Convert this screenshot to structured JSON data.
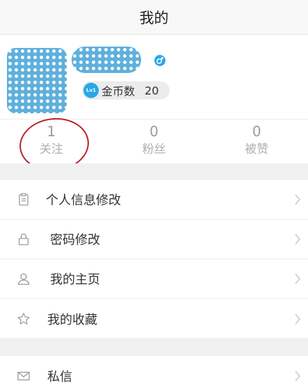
{
  "header": {
    "title": "我的"
  },
  "profile": {
    "coin_label": "金币数",
    "coin_value": "20",
    "level_badge": "Lv1",
    "gender_icon": "male-icon"
  },
  "stats": [
    {
      "value": "1",
      "label": "关注"
    },
    {
      "value": "0",
      "label": "粉丝"
    },
    {
      "value": "0",
      "label": "被赞"
    }
  ],
  "menu": [
    {
      "label": "个人信息修改",
      "icon": "clipboard-icon"
    },
    {
      "label": "密码修改",
      "icon": "lock-icon"
    },
    {
      "label": "我的主页",
      "icon": "user-icon"
    },
    {
      "label": "我的收藏",
      "icon": "star-icon"
    }
  ],
  "menu2": [
    {
      "label": "私信",
      "icon": "mail-icon"
    }
  ],
  "colors": {
    "accent": "#2aa7e8",
    "annotation": "#b8232a",
    "avatar_blur": "#5fb0dc"
  }
}
